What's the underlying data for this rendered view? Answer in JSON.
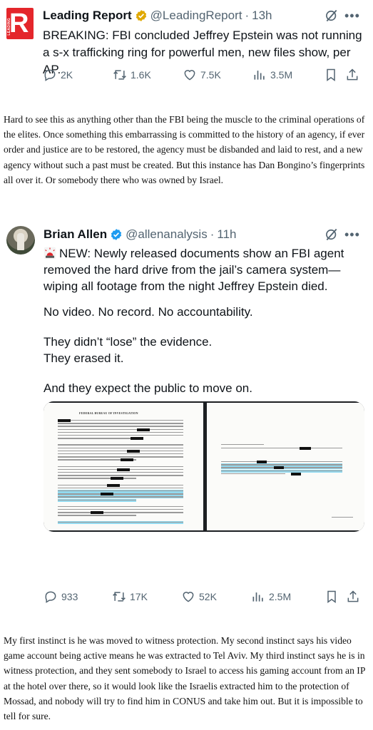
{
  "tweet1": {
    "logo_letter": "R",
    "logo_sub": "LEADING",
    "author_name": "Leading Report",
    "handle": "@LeadingReport",
    "separator": "·",
    "time": "13h",
    "text": "BREAKING: FBI concluded Jeffrey Epstein was not running a s-x trafficking ring for powerful men, new files show, per AP.",
    "replies": "2K",
    "reposts": "1.6K",
    "likes": "7.5K",
    "views": "3.5M"
  },
  "comment1": "Hard to see this as anything other than the FBI being the muscle to the criminal operations of the elites. Once something this embarrassing is committed to the history of an agency, if ever order and justice are to be restored, the agency must be disbanded and laid to rest, and a new agency without such a past must be created. But this instance has Dan Bongino’s fingerprints all over it. Or somebody there who was owned by Israel.",
  "tweet2": {
    "author_name": "Brian Allen",
    "handle": "@allenanalysis",
    "separator": "·",
    "time": "11h",
    "paragraph1": "NEW: Newly released documents show an FBI agent removed the hard drive from the jail’s camera system—wiping all footage from the night Jeffrey Epstein died.",
    "paragraph2": "No video. No record. No accountability.",
    "paragraph3_line1": "They didn’t “lose” the evidence.",
    "paragraph3_line2": "They erased it.",
    "paragraph4": "And they expect the public to move on.",
    "doc_header": "FEDERAL BUREAU OF INVESTIGATION",
    "replies": "933",
    "reposts": "17K",
    "likes": "52K",
    "views": "2.5M"
  },
  "comment2": "My first instinct is he was moved to witness protection. My second instinct says his video game account being active means he was extracted to Tel Aviv. My third instinct says he is in witness protection, and they sent somebody to Israel to access his gaming account from an IP at the hotel over there, so it would look like the Israelis extracted him to the protection of Mossad, and nobody will try to find him in CONUS and take him out. But it is impossible to tell for sure.",
  "colors": {
    "text": "#0f1419",
    "secondary": "#536471",
    "verified": "#1d9bf0",
    "logo_red": "#e4262b",
    "highlight": "#7fd3ee"
  },
  "icons": [
    "verified-badge-icon",
    "grok-icon",
    "more-icon",
    "reply-icon",
    "repost-icon",
    "like-icon",
    "views-icon",
    "bookmark-icon",
    "share-icon",
    "siren-icon"
  ]
}
